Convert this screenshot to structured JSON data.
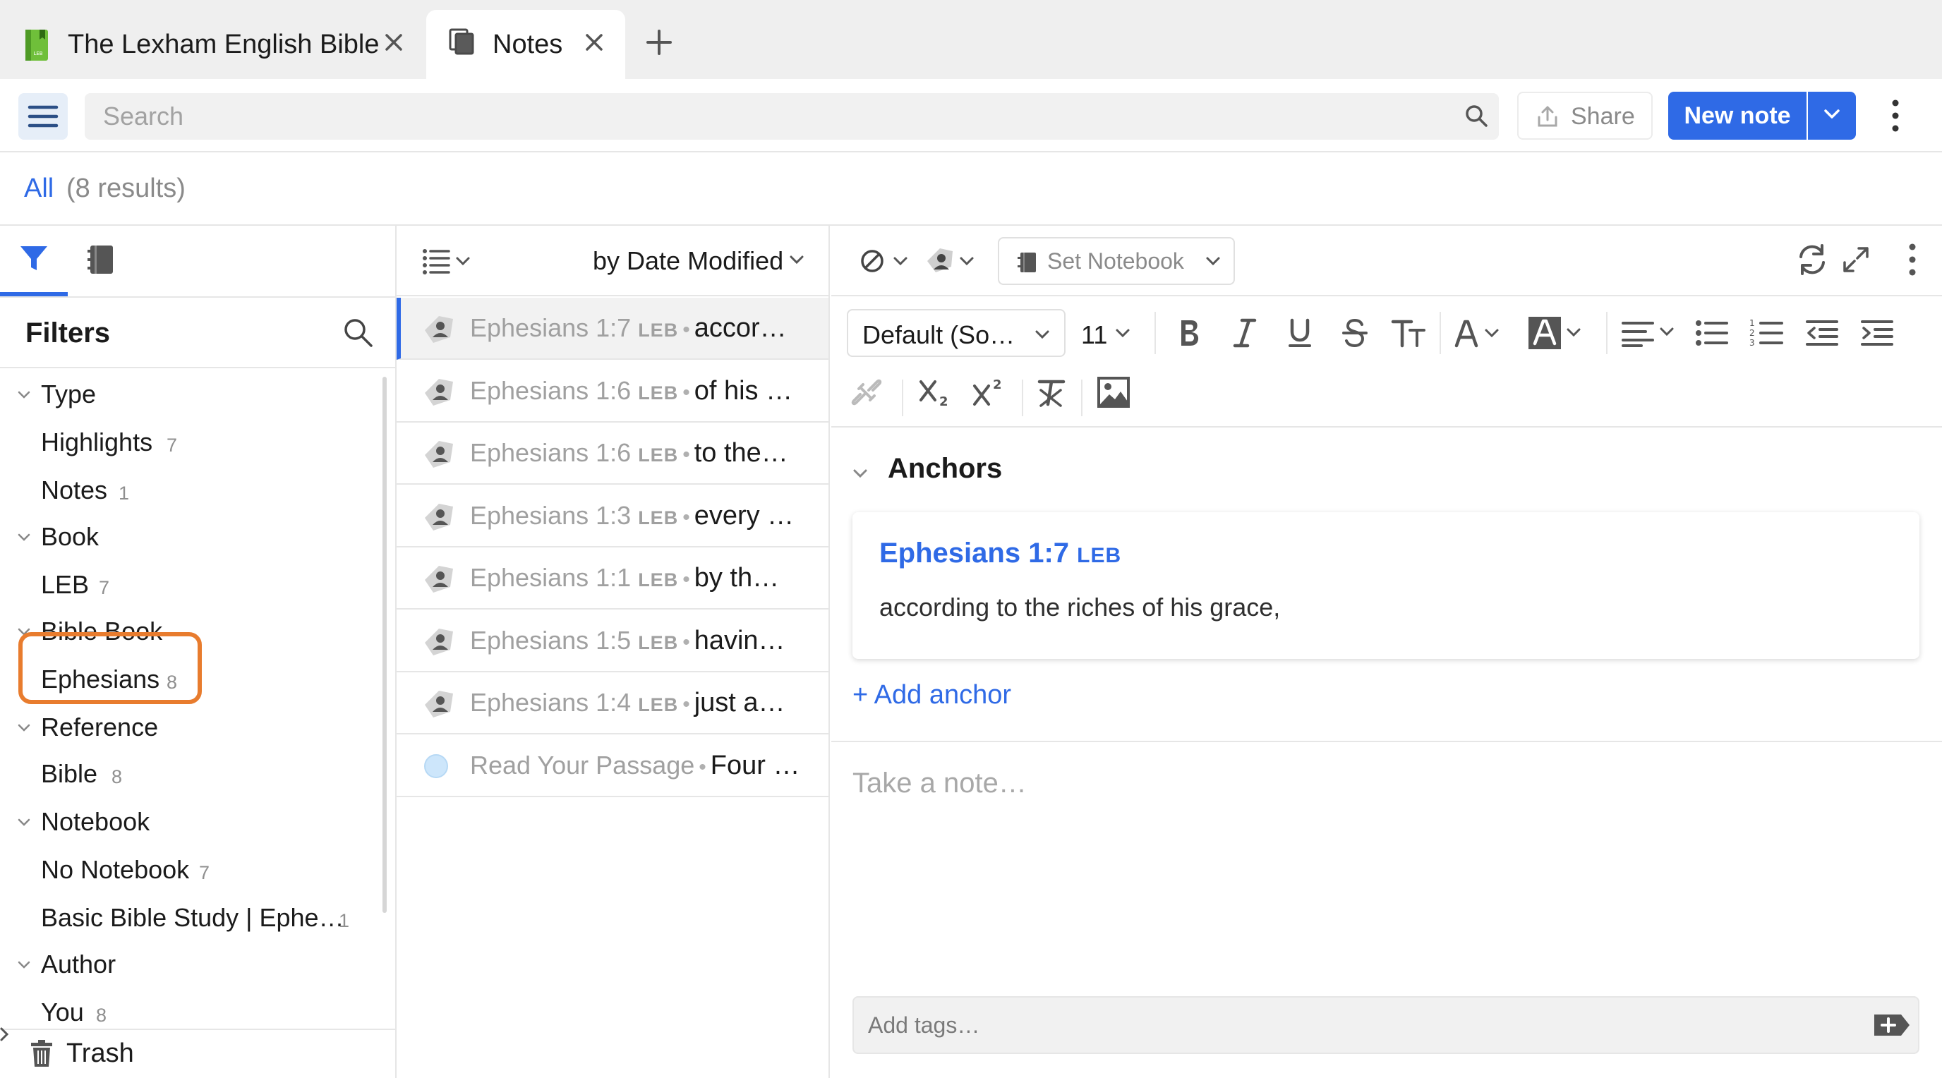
{
  "tabs": [
    {
      "title": "The Lexham English Bible",
      "icon": "book-icon",
      "active": false
    },
    {
      "title": "Notes",
      "icon": "notes-icon",
      "active": true
    }
  ],
  "toolbar": {
    "search_placeholder": "Search",
    "share_label": "Share",
    "new_note_label": "New note"
  },
  "results": {
    "all_label": "All",
    "count_label": "(8 results)"
  },
  "filters": {
    "title": "Filters",
    "groups": [
      {
        "label": "Type",
        "items": [
          {
            "label": "Highlights",
            "count": "7"
          },
          {
            "label": "Notes",
            "count": "1"
          }
        ]
      },
      {
        "label": "Book",
        "items": [
          {
            "label": "LEB",
            "count": "7"
          }
        ]
      },
      {
        "label": "Bible Book",
        "items": [
          {
            "label": "Ephesians",
            "count": "8"
          }
        ]
      },
      {
        "label": "Reference",
        "items": [
          {
            "label": "Bible",
            "count": "8"
          }
        ]
      },
      {
        "label": "Notebook",
        "items": [
          {
            "label": "No Notebook",
            "count": "7"
          },
          {
            "label": "Basic Bible Study | Ephe…",
            "count": "1"
          }
        ]
      },
      {
        "label": "Author",
        "items": [
          {
            "label": "You",
            "count": "8"
          }
        ]
      }
    ],
    "trash_label": "Trash"
  },
  "list": {
    "sort_label": "by Date Modified",
    "rows": [
      {
        "ref": "Ephesians 1:7",
        "tag": "LEB",
        "preview": "accor…",
        "kind": "highlight"
      },
      {
        "ref": "Ephesians 1:6",
        "tag": "LEB",
        "preview": "of his …",
        "kind": "highlight"
      },
      {
        "ref": "Ephesians 1:6",
        "tag": "LEB",
        "preview": "to the…",
        "kind": "highlight"
      },
      {
        "ref": "Ephesians 1:3",
        "tag": "LEB",
        "preview": "every …",
        "kind": "highlight"
      },
      {
        "ref": "Ephesians 1:1",
        "tag": "LEB",
        "preview": "by th…",
        "kind": "highlight"
      },
      {
        "ref": "Ephesians 1:5",
        "tag": "LEB",
        "preview": "havin…",
        "kind": "highlight"
      },
      {
        "ref": "Ephesians 1:4",
        "tag": "LEB",
        "preview": "just a…",
        "kind": "highlight"
      },
      {
        "ref": "Read Your Passage",
        "tag": "",
        "preview": "Four …",
        "kind": "note"
      }
    ]
  },
  "editor": {
    "set_notebook_label": "Set Notebook",
    "font_label": "Default (So…",
    "size_label": "11",
    "anchors_title": "Anchors",
    "anchor": {
      "ref": "Ephesians 1:7",
      "tag": "LEB",
      "text": "according to the riches of his grace,"
    },
    "add_anchor_label": "+ Add anchor",
    "note_placeholder": "Take a note…",
    "tags_placeholder": "Add tags…"
  },
  "colors": {
    "accent": "#2f6ae6",
    "highlight_ring": "#e87c2e",
    "tab_bg": "#efefef"
  }
}
